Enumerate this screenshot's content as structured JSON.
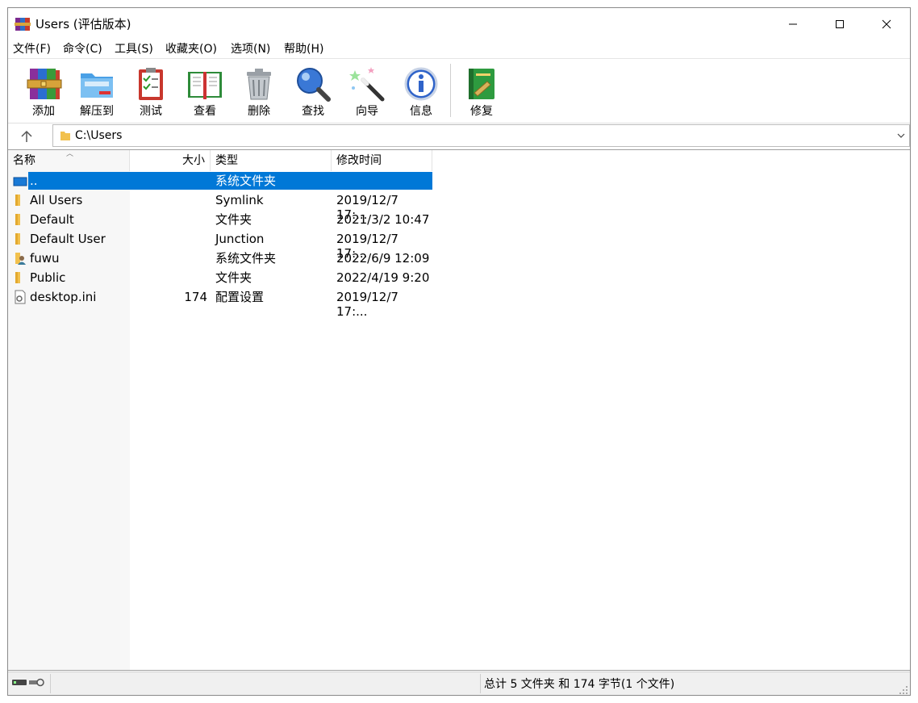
{
  "window": {
    "title": "Users (评估版本)"
  },
  "menu": [
    {
      "label": "文件(F)"
    },
    {
      "label": "命令(C)"
    },
    {
      "label": "工具(S)"
    },
    {
      "label": "收藏夹(O)"
    },
    {
      "label": "选项(N)"
    },
    {
      "label": "帮助(H)"
    }
  ],
  "toolbar": [
    {
      "label": "添加",
      "icon": "archive-books-icon"
    },
    {
      "label": "解压到",
      "icon": "folder-extract-icon"
    },
    {
      "label": "测试",
      "icon": "clipboard-check-icon"
    },
    {
      "label": "查看",
      "icon": "open-book-icon"
    },
    {
      "label": "删除",
      "icon": "trash-can-icon"
    },
    {
      "label": "查找",
      "icon": "magnifier-icon"
    },
    {
      "label": "向导",
      "icon": "magic-wand-icon"
    },
    {
      "label": "信息",
      "icon": "info-icon"
    },
    {
      "label": "修复",
      "icon": "repair-book-icon"
    }
  ],
  "address": {
    "path": "C:\\Users"
  },
  "columns": {
    "name": "名称",
    "size": "大小",
    "type": "类型",
    "modified": "修改时间"
  },
  "rows": [
    {
      "name": "..",
      "size": "",
      "type": "系统文件夹",
      "modified": "",
      "icon": "drive-icon",
      "selected": true
    },
    {
      "name": "All Users",
      "size": "",
      "type": "Symlink",
      "modified": "2019/12/7 17:...",
      "icon": "folder-icon"
    },
    {
      "name": "Default",
      "size": "",
      "type": "文件夹",
      "modified": "2021/3/2 10:47",
      "icon": "folder-icon"
    },
    {
      "name": "Default User",
      "size": "",
      "type": "Junction",
      "modified": "2019/12/7 17:...",
      "icon": "folder-icon"
    },
    {
      "name": "fuwu",
      "size": "",
      "type": "系统文件夹",
      "modified": "2022/6/9 12:09",
      "icon": "user-folder-icon"
    },
    {
      "name": "Public",
      "size": "",
      "type": "文件夹",
      "modified": "2022/4/19 9:20",
      "icon": "folder-icon"
    },
    {
      "name": "desktop.ini",
      "size": "174",
      "type": "配置设置",
      "modified": "2019/12/7 17:...",
      "icon": "settings-file-icon"
    }
  ],
  "status": {
    "summary": "总计 5 文件夹 和 174 字节(1 个文件)"
  },
  "colors": {
    "selection": "#0078d7",
    "folder": "#f2c14e"
  }
}
